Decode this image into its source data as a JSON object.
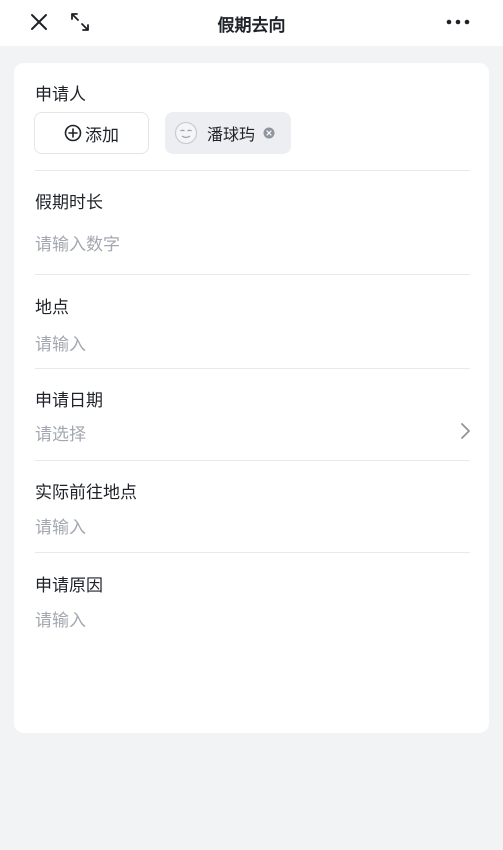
{
  "header": {
    "title": "假期去向",
    "icons": [
      "close-icon",
      "expand-icon",
      "more-icon"
    ]
  },
  "form": {
    "applicant": {
      "label": "申请人",
      "add_label": "添加",
      "selected": [
        {
          "name": "潘球玙",
          "avatar": "avatar-icon"
        }
      ]
    },
    "duration": {
      "label": "假期时长",
      "placeholder": "请输入数字"
    },
    "location": {
      "label": "地点",
      "placeholder": "请输入"
    },
    "apply_date": {
      "label": "申请日期",
      "placeholder": "请选择"
    },
    "actual_location": {
      "label": "实际前往地点",
      "placeholder": "请输入"
    },
    "reason": {
      "label": "申请原因",
      "placeholder": "请输入"
    }
  },
  "colors": {
    "background": "#f2f3f5",
    "card": "#ffffff",
    "text": "#1f2329",
    "placeholder": "#a3a8b0",
    "divider": "#e8e9eb",
    "chip": "#eceef1"
  }
}
